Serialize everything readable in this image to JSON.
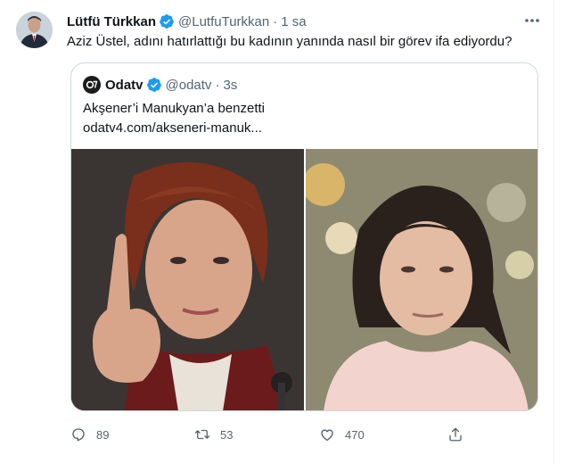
{
  "tweet": {
    "display_name": "Lütfü Türkkan",
    "handle": "@LutfuTurkkan",
    "separator": "·",
    "time": "1 sa",
    "text": "Aziz Üstel, adını hatırlattığı bu kadının yanında nasıl bir görev ifa ediyordu?"
  },
  "quote": {
    "display_name": "Odatv",
    "handle": "@odatv",
    "separator": "·",
    "time": "3s",
    "text": "Akşener’i Manukyan’a benzetti",
    "link": "odatv4.com/akseneri-manuk..."
  },
  "actions": {
    "reply_count": "89",
    "retweet_count": "53",
    "like_count": "470"
  },
  "icons": {
    "reply": "reply-icon",
    "retweet": "retweet-icon",
    "like": "heart-icon",
    "share": "share-icon",
    "more": "more-icon",
    "verified": "verified-badge-icon"
  },
  "colors": {
    "verified": "#1d9bf0",
    "text": "#0f1419",
    "secondary": "#536471",
    "border": "#cfd9de"
  }
}
